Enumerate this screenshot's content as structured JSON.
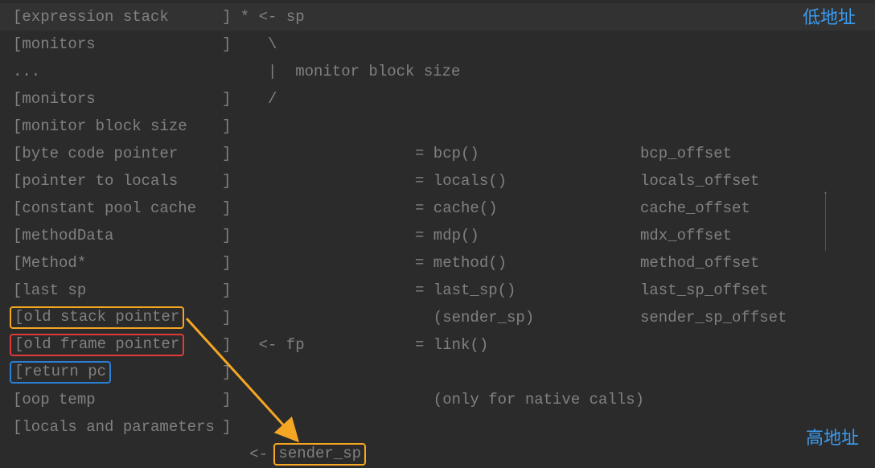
{
  "labels": {
    "low_addr": "低地址",
    "high_addr": "高地址"
  },
  "box_targets": {
    "sender_sp": "sender_sp"
  },
  "rows": [
    {
      "name": "[expression stack",
      "mid": "] * <- sp",
      "func": "",
      "off": "",
      "hl": true
    },
    {
      "name": "[monitors",
      "mid": "]    \\",
      "func": "",
      "off": ""
    },
    {
      "name": "...",
      "mid": "     |  monitor block size",
      "func": "",
      "off": ""
    },
    {
      "name": "[monitors",
      "mid": "]    /",
      "func": "",
      "off": ""
    },
    {
      "name": "[monitor block size",
      "mid": "]",
      "func": "",
      "off": ""
    },
    {
      "name": "[byte code pointer",
      "mid": "]",
      "func": "= bcp()",
      "off": "bcp_offset"
    },
    {
      "name": "[pointer to locals",
      "mid": "]",
      "func": "= locals()",
      "off": "locals_offset"
    },
    {
      "name": "[constant pool cache",
      "mid": "]",
      "func": "= cache()",
      "off": "cache_offset"
    },
    {
      "name": "[methodData",
      "mid": "]",
      "func": "= mdp()",
      "off": "mdx_offset"
    },
    {
      "name": "[Method*",
      "mid": "]",
      "func": "= method()",
      "off": "method_offset"
    },
    {
      "name": "[last sp",
      "mid": "]",
      "func": "= last_sp()",
      "off": "last_sp_offset"
    },
    {
      "name": "[old stack pointer",
      "mid": "]",
      "func": "  (sender_sp)",
      "off": "sender_sp_offset",
      "box": "yellow"
    },
    {
      "name": "[old frame pointer",
      "mid": "]   <- fp",
      "func": "= link()",
      "off": "",
      "box": "red"
    },
    {
      "name": "[return pc",
      "mid": "]",
      "func": "",
      "off": "",
      "box": "blue"
    },
    {
      "name": "[oop temp",
      "mid": "]",
      "func": "  (only for native calls)",
      "off": ""
    },
    {
      "name": "[locals and parameters",
      "mid": "]",
      "func": "",
      "off": ""
    }
  ],
  "colors": {
    "yellow": "#f5a623",
    "red": "#e03b3b",
    "blue_box": "#2a7fd4",
    "blue_arrow": "#3b9bf0",
    "bg": "#2b2b2b",
    "text": "#808080"
  }
}
